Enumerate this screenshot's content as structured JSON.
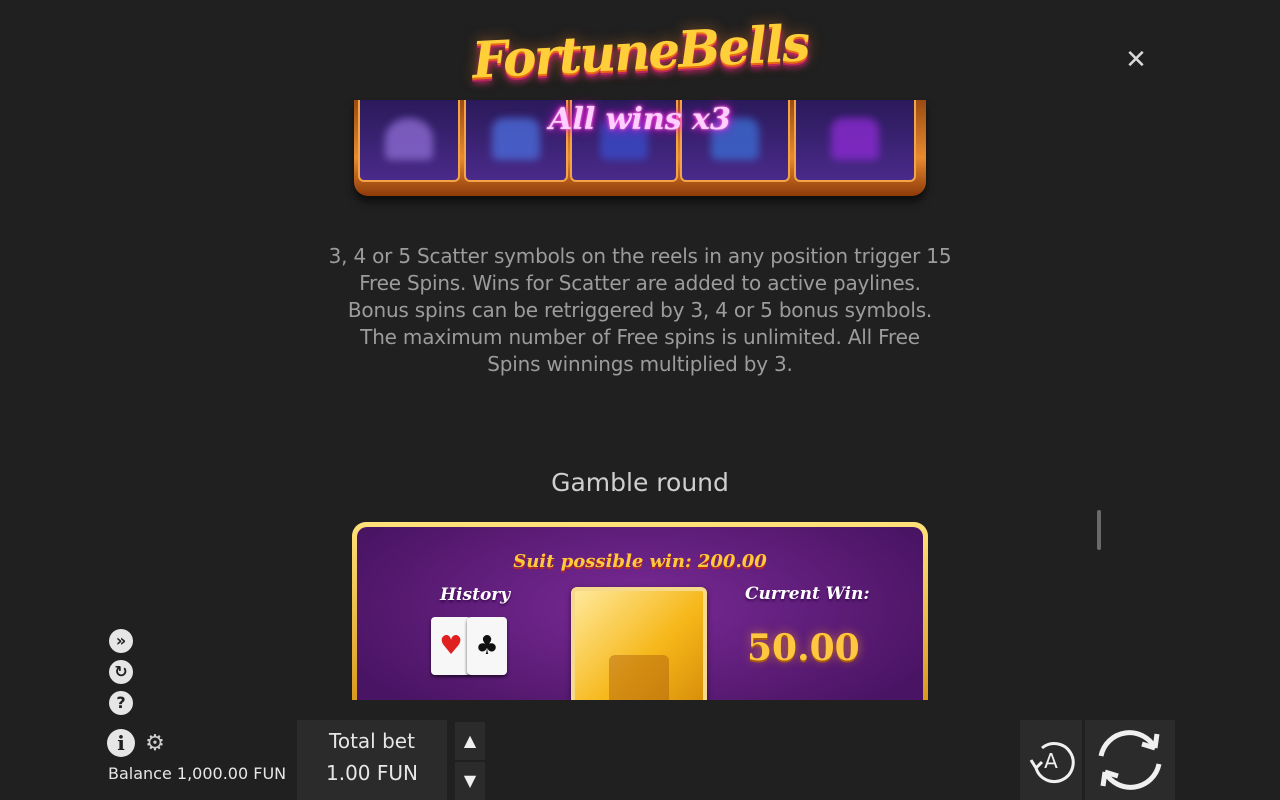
{
  "logo": {
    "text": "FortuneBells"
  },
  "reels": {
    "multiplier_text": "All wins x3"
  },
  "rules": {
    "free_spins_lines": [
      "3, 4 or 5 Scatter symbols on the reels in any position trigger 15",
      "Free Spins. Wins for Scatter are added to active paylines.",
      "Bonus spins can be retriggered by 3, 4 or 5 bonus symbols.",
      "The maximum number of Free spins is unlimited. All Free",
      "Spins winnings multiplied by 3."
    ],
    "gamble_title": "Gamble round"
  },
  "gamble": {
    "suit_possible_win": "Suit possible win: 200.00",
    "history_label": "History",
    "current_win_label": "Current Win:",
    "current_win_value": "50.00"
  },
  "hud": {
    "balance": "Balance 1,000.00 FUN",
    "total_bet_label": "Total bet",
    "total_bet_value": "1.00 FUN",
    "auto_label": "A"
  },
  "colors": {
    "background": "#202020",
    "gold": "#ffc640",
    "purple": "#4a1464"
  }
}
